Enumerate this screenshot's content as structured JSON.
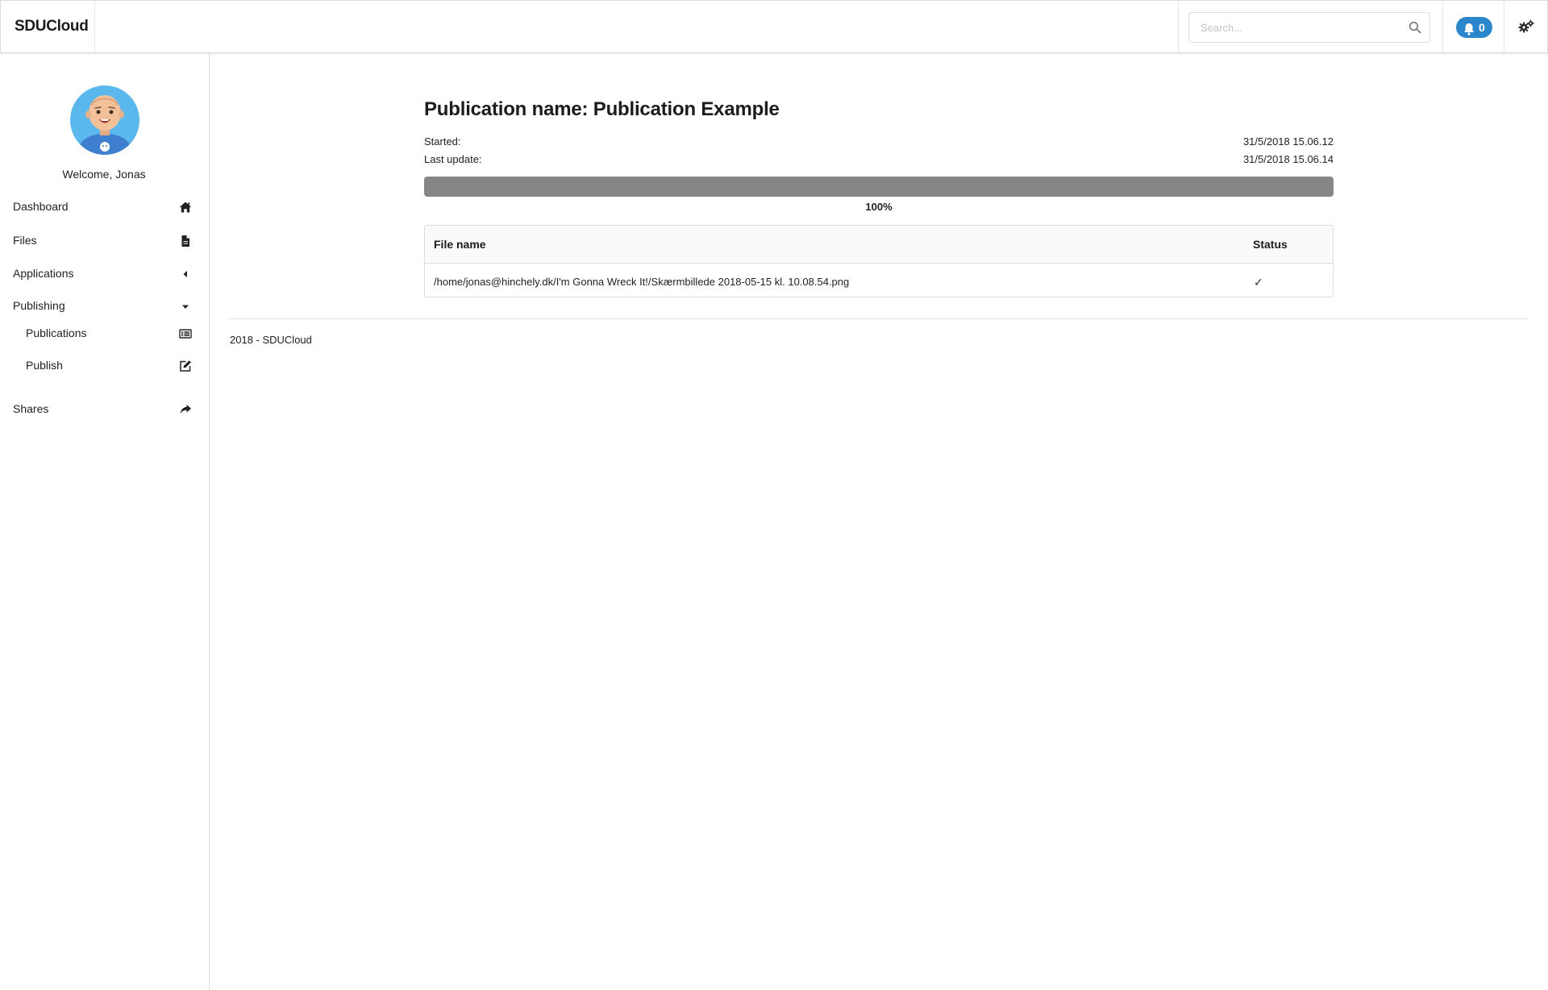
{
  "header": {
    "brand": "SDUCloud",
    "search_placeholder": "Search...",
    "notifications_count": "0"
  },
  "sidebar": {
    "welcome": "Welcome, Jonas",
    "items": [
      {
        "label": "Dashboard",
        "icon": "home-icon"
      },
      {
        "label": "Files",
        "icon": "file-icon"
      },
      {
        "label": "Applications",
        "icon": "caret-left-icon"
      },
      {
        "label": "Publishing",
        "icon": "caret-down-icon"
      },
      {
        "label": "Publications",
        "icon": "list-icon"
      },
      {
        "label": "Publish",
        "icon": "edit-icon"
      },
      {
        "label": "Shares",
        "icon": "share-icon"
      }
    ]
  },
  "main": {
    "title": "Publication name: Publication Example",
    "started_label": "Started:",
    "started_value": "31/5/2018 15.06.12",
    "updated_label": "Last update:",
    "updated_value": "31/5/2018 15.06.14",
    "progress_fraction": 1.0,
    "progress_text": "100%",
    "table": {
      "columns": [
        "File name",
        "Status"
      ],
      "rows": [
        {
          "file": "/home/jonas@hinchely.dk/I'm Gonna Wreck It!/Skærmbillede 2018-05-15 kl. 10.08.54.png",
          "status": "✓"
        }
      ]
    }
  },
  "footer": {
    "text": "2018 - SDUCloud"
  },
  "colors": {
    "accent": "#2b86cc",
    "progress": "#868686",
    "avatar_bg": "#5ab8ec"
  }
}
